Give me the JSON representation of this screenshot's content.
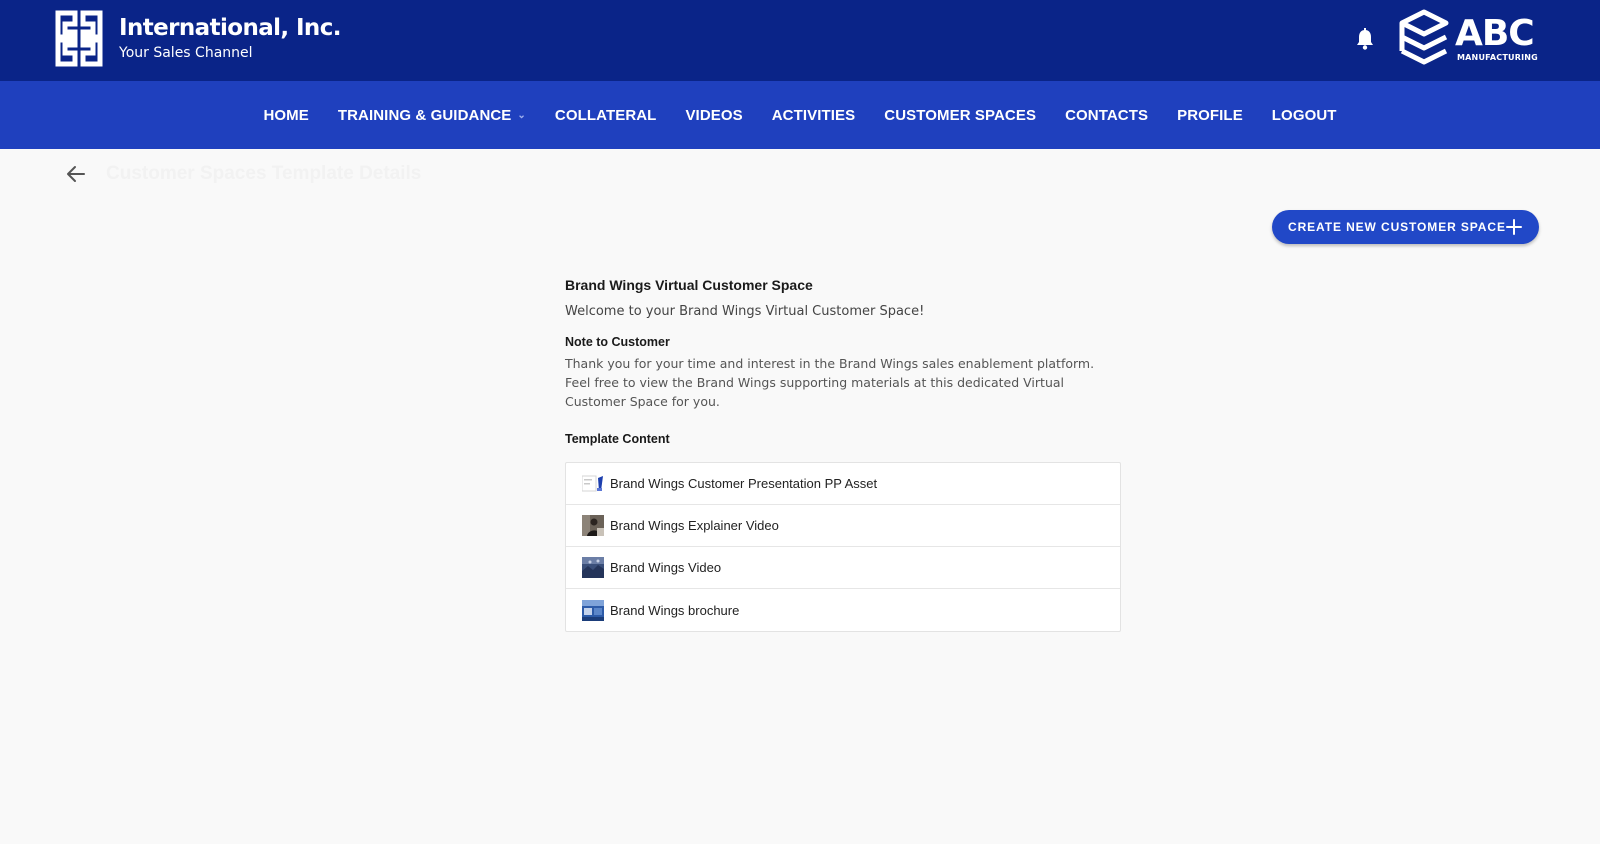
{
  "header": {
    "brand_name": "International, Inc.",
    "brand_tagline": "Your Sales Channel",
    "partner_logo_text": "ABC",
    "partner_logo_subtext": "MANUFACTURING",
    "colors": {
      "topbar": "#0a2488",
      "nav": "#1f40be",
      "accent": "#2148c7"
    }
  },
  "nav": {
    "items": [
      {
        "label": "HOME"
      },
      {
        "label": "TRAINING & GUIDANCE",
        "has_dropdown": true
      },
      {
        "label": "COLLATERAL"
      },
      {
        "label": "VIDEOS"
      },
      {
        "label": "ACTIVITIES"
      },
      {
        "label": "CUSTOMER SPACES"
      },
      {
        "label": "CONTACTS"
      },
      {
        "label": "PROFILE"
      },
      {
        "label": "LOGOUT"
      }
    ]
  },
  "page": {
    "title": "Customer Spaces Template Details",
    "create_button": "CREATE NEW CUSTOMER SPACE"
  },
  "space": {
    "title": "Brand Wings Virtual Customer Space",
    "welcome": "Welcome to your Brand Wings Virtual Customer Space!",
    "note_label": "Note to Customer",
    "note_text": "Thank you for your time and interest in the Brand Wings sales enablement platform. Feel free to view the Brand Wings supporting materials at this dedicated Virtual Customer Space for you.",
    "template_label": "Template Content",
    "items": [
      {
        "label": "Brand Wings Customer Presentation PP Asset",
        "icon": "presentation-thumbnail-icon"
      },
      {
        "label": "Brand Wings Explainer Video",
        "icon": "video-thumbnail-icon"
      },
      {
        "label": "Brand Wings Video",
        "icon": "video-thumbnail-icon"
      },
      {
        "label": "Brand Wings brochure",
        "icon": "brochure-thumbnail-icon"
      }
    ]
  }
}
